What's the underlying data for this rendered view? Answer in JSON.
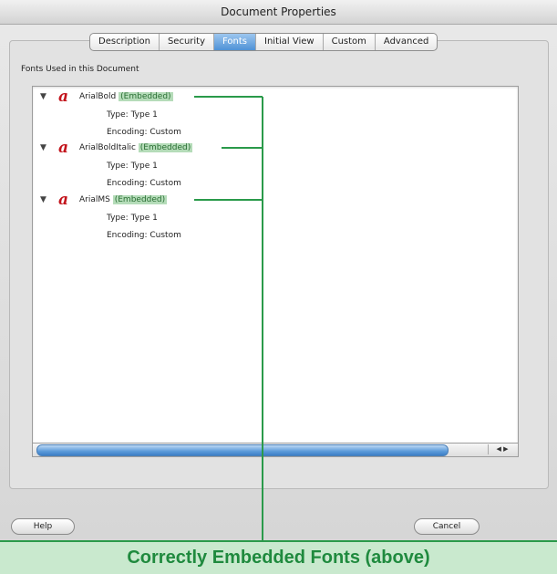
{
  "window": {
    "title": "Document Properties"
  },
  "tabs": [
    {
      "label": "Description",
      "active": false
    },
    {
      "label": "Security",
      "active": false
    },
    {
      "label": "Fonts",
      "active": true
    },
    {
      "label": "Initial View",
      "active": false
    },
    {
      "label": "Custom",
      "active": false
    },
    {
      "label": "Advanced",
      "active": false
    }
  ],
  "fonts_group": {
    "label": "Fonts Used in this Document",
    "fonts": [
      {
        "name": "ArialBold",
        "status": "(Embedded)",
        "type": "Type: Type 1",
        "encoding": "Encoding: Custom"
      },
      {
        "name": "ArialBoldItalic",
        "status": "(Embedded)",
        "type": "Type: Type 1",
        "encoding": "Encoding: Custom"
      },
      {
        "name": "ArialMS",
        "status": "(Embedded)",
        "type": "Type: Type 1",
        "encoding": "Encoding: Custom"
      }
    ],
    "icon": "acrobat-font-icon",
    "scroll_arrows": "◀ ▶"
  },
  "buttons": {
    "help": "Help",
    "cancel": "Cancel"
  },
  "annotation": {
    "caption": "Correctly Embedded Fonts (above)",
    "color": "#1f8a3e"
  }
}
